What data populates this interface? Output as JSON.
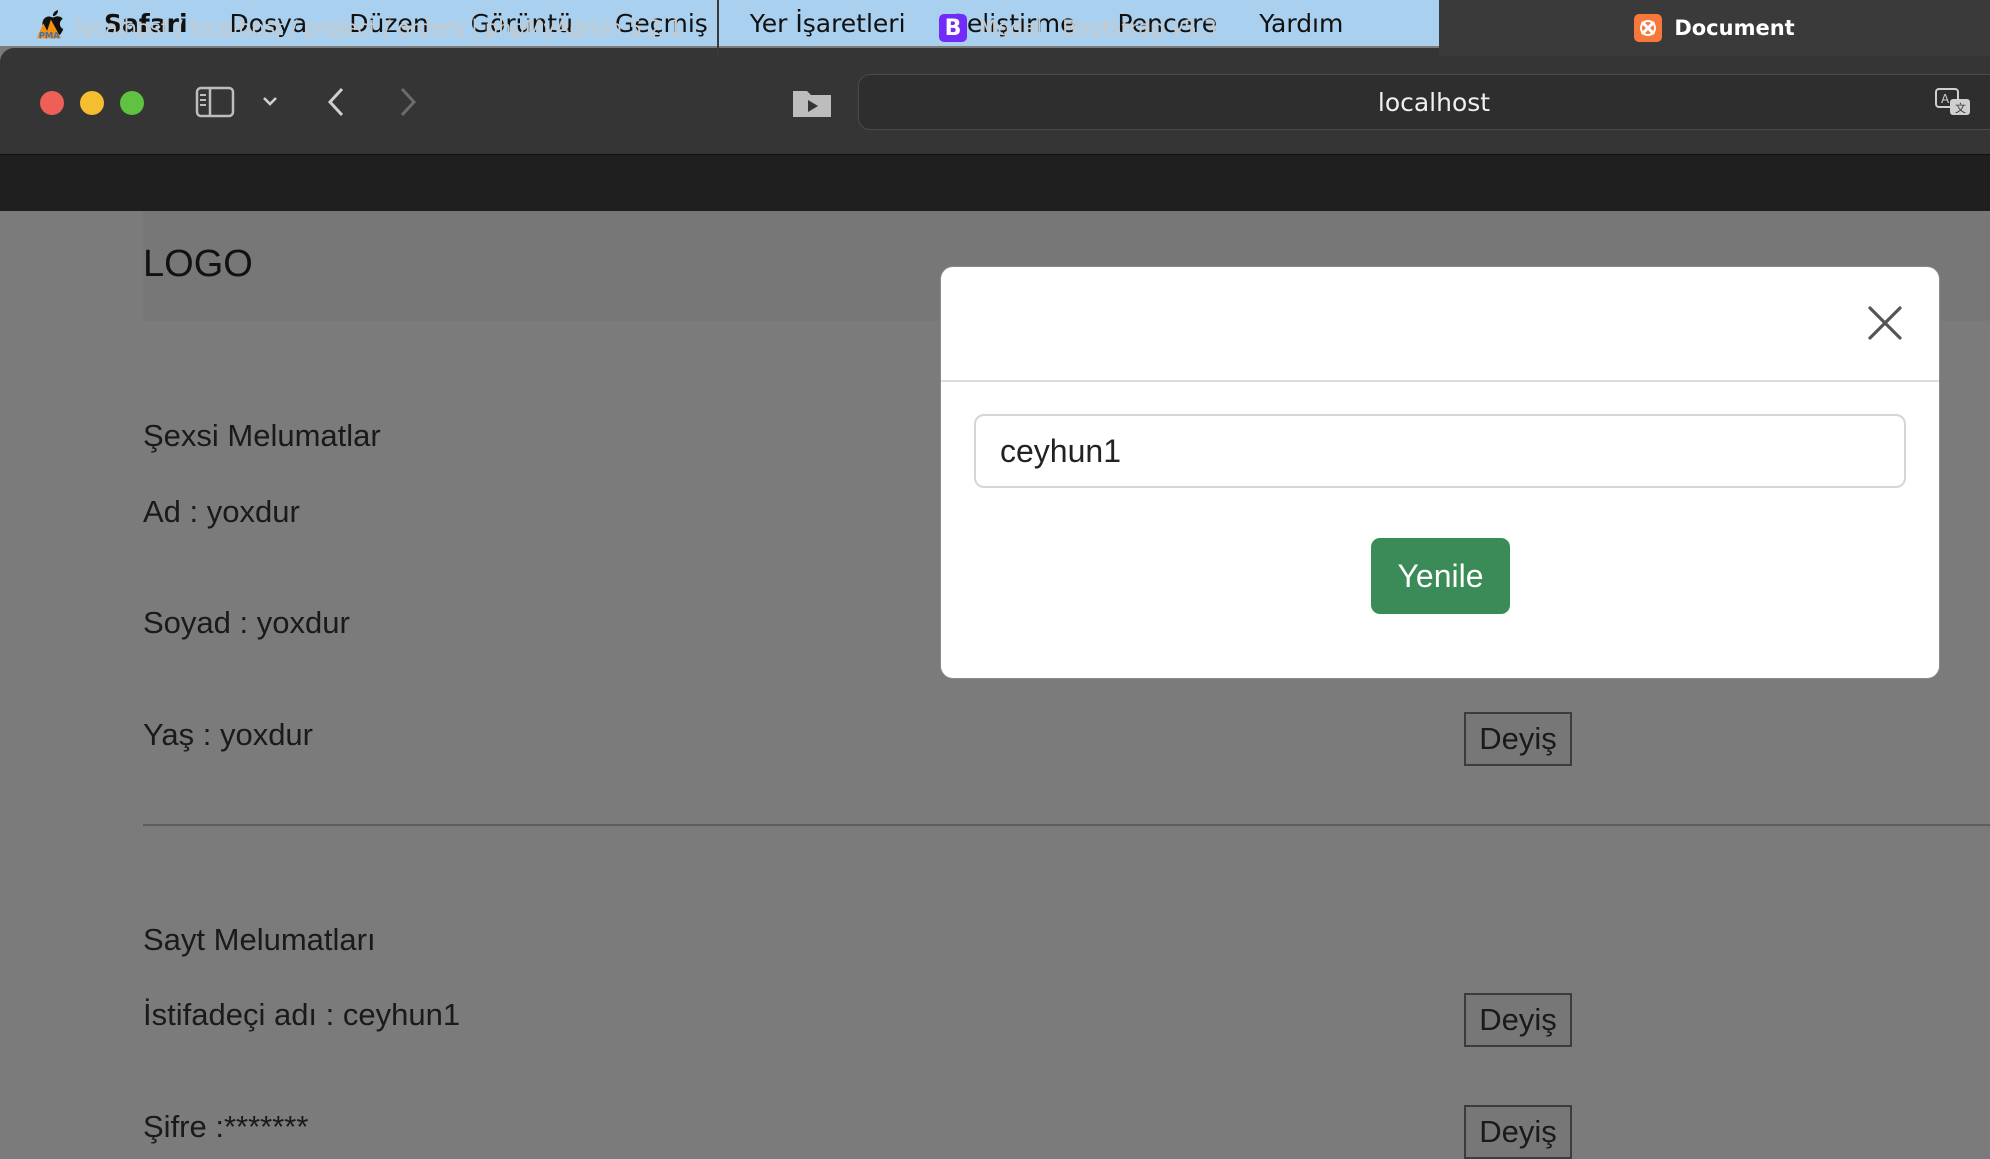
{
  "menubar": {
    "app": "Safari",
    "items": [
      "Dosya",
      "Düzen",
      "Görüntü",
      "Geçmiş",
      "Yer İşaretleri",
      "Geliştirme",
      "Pencere",
      "Yardım"
    ]
  },
  "toolbar": {
    "url": "localhost",
    "icons": [
      "sidebar-icon",
      "chevron-down-icon",
      "back-icon",
      "forward-icon",
      "media-folder-icon",
      "translate-icon"
    ]
  },
  "tabs": [
    {
      "label": "localhost / localhost / project / orders | phpMyAdmin 5.2.1",
      "favicon": "phpmyadmin-icon",
      "active": false
    },
    {
      "label": "Modal · Bootstrap v5.3",
      "favicon": "bootstrap-icon",
      "active": false
    },
    {
      "label": "Document",
      "favicon": "xampp-icon",
      "active": true
    }
  ],
  "page": {
    "logo": "LOGO",
    "personal": {
      "heading": "Şexsi Melumatlar",
      "name": "Ad : yoxdur",
      "surname": "Soyad : yoxdur",
      "age": "Yaş : yoxdur"
    },
    "site": {
      "heading": "Sayt Melumatları",
      "username": "İstifadeçi adı : ceyhun1",
      "password": "Şifre :*******"
    },
    "change_label": "Deyiş"
  },
  "modal": {
    "input_value": "ceyhun1",
    "submit_label": "Yenile"
  },
  "colors": {
    "menubar_bg": "#a9d0ee",
    "success_green": "#3a8b57",
    "backdrop": "#7b7b7b"
  }
}
